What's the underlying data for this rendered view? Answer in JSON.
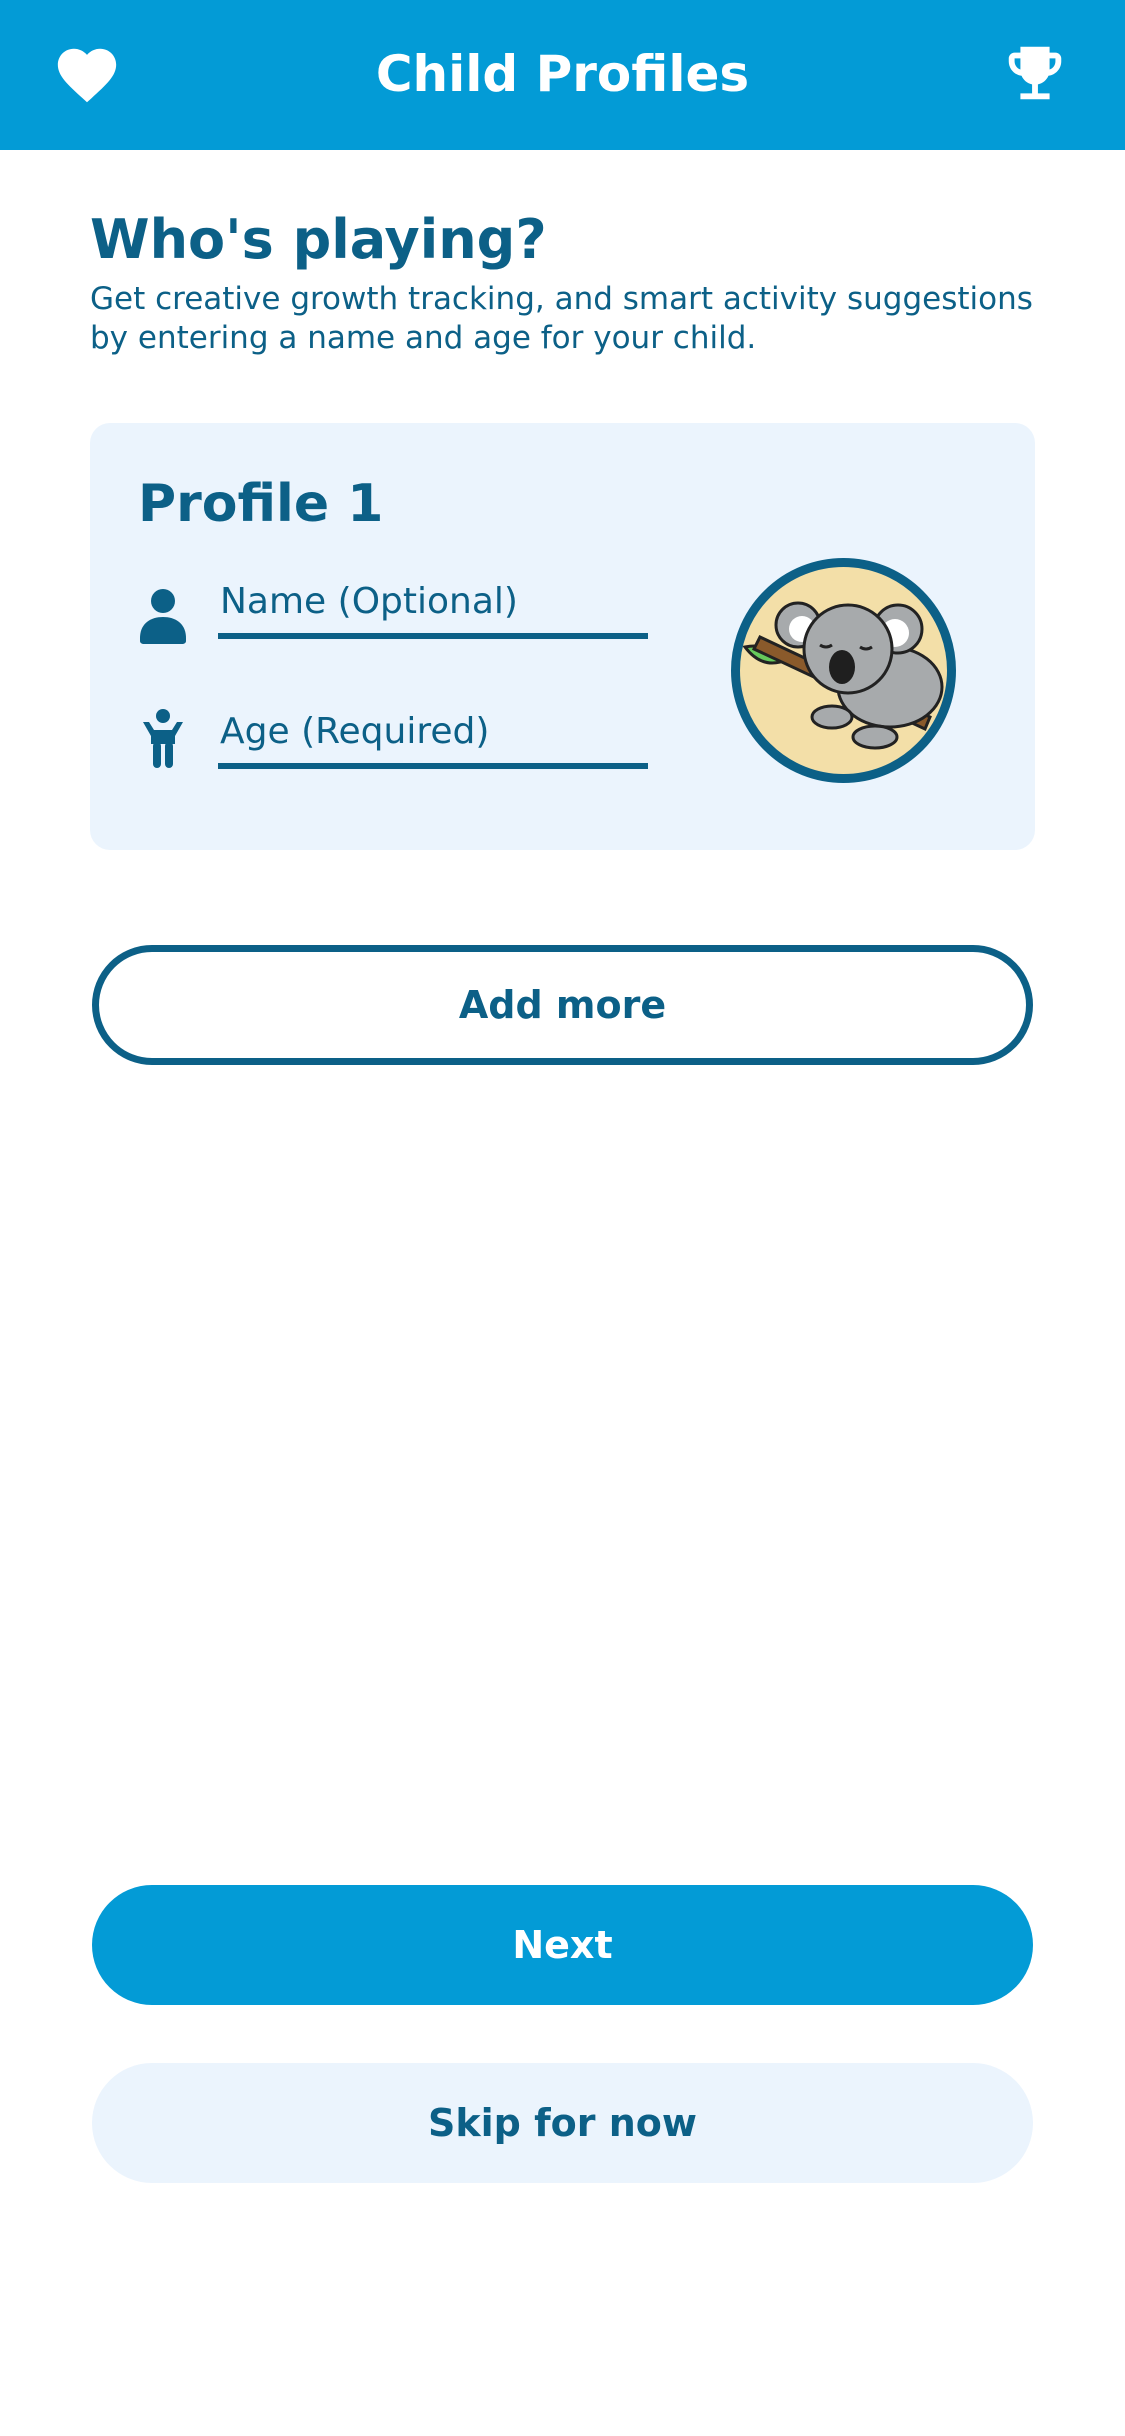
{
  "header": {
    "title": "Child Profiles",
    "left_icon": "heart-icon",
    "right_icon": "trophy-icon"
  },
  "intro": {
    "heading": "Who's playing?",
    "description": "Get creative growth tracking, and smart activity suggestions by entering a name and age for your child."
  },
  "profile": {
    "title": "Profile 1",
    "name_field": {
      "placeholder": "Name (Optional)",
      "value": "",
      "icon": "person-icon"
    },
    "age_field": {
      "placeholder": "Age (Required)",
      "value": "",
      "icon": "child-icon"
    },
    "avatar": "koala-avatar"
  },
  "buttons": {
    "add_more": "Add more",
    "next": "Next",
    "skip": "Skip for now"
  },
  "colors": {
    "primary": "#039bd6",
    "dark_text": "#0c6087",
    "light_bg": "#ebf4fd",
    "avatar_bg": "#f3dfa8"
  }
}
